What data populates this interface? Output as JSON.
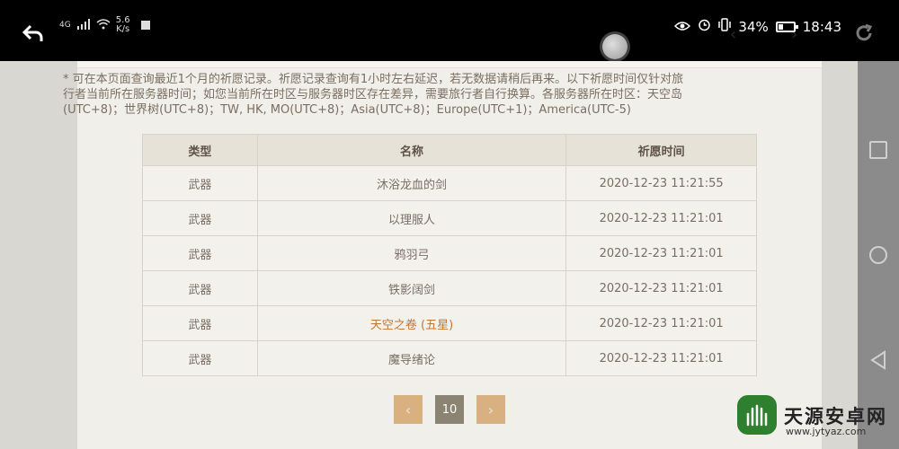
{
  "status_bar": {
    "network_type": "4G",
    "net_speed_value": "5.6",
    "net_speed_unit": "K/s",
    "battery": "34%",
    "battery_level": 0.34,
    "time": "18:43"
  },
  "notice": "* 可在本页面查询最近1个月的祈愿记录。祈愿记录查询有1小时左右延迟，若无数据请稍后再来。以下祈愿时间仅针对旅行者当前所在服务器时间；如您当前所在时区与服务器时区存在差异，需要旅行者自行换算。各服务器所在时区：天空岛(UTC+8)；世界树(UTC+8)；TW, HK, MO(UTC+8)；Asia(UTC+8)；Europe(UTC+1)；America(UTC-5)",
  "table": {
    "headers": [
      "类型",
      "名称",
      "祈愿时间"
    ],
    "rows": [
      {
        "type": "武器",
        "name": "沐浴龙血的剑",
        "time": "2020-12-23 11:21:55"
      },
      {
        "type": "武器",
        "name": "以理服人",
        "time": "2020-12-23 11:21:01"
      },
      {
        "type": "武器",
        "name": "鸦羽弓",
        "time": "2020-12-23 11:21:01"
      },
      {
        "type": "武器",
        "name": "铁影阔剑",
        "time": "2020-12-23 11:21:01"
      },
      {
        "type": "武器",
        "name": "天空之卷 (五星)",
        "time": "2020-12-23 11:21:01"
      },
      {
        "type": "武器",
        "name": "魔导绪论",
        "time": "2020-12-23 11:21:01"
      }
    ]
  },
  "pager": {
    "prev": "‹",
    "current": "10",
    "next": "›"
  },
  "watermark": {
    "title": "天源安卓网",
    "url": "www.jytyaz.com"
  },
  "colors": {
    "five_star": "#c07733",
    "pager_button": "#d9b080",
    "pager_current": "#8b8472"
  }
}
